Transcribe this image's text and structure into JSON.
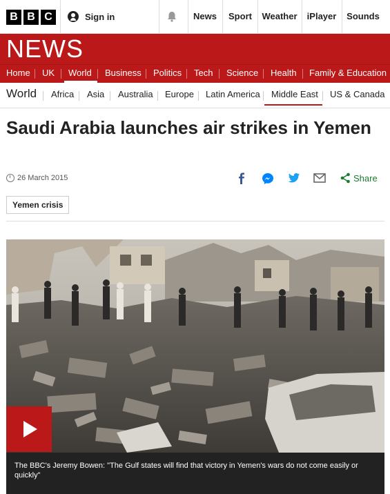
{
  "header": {
    "logo_letters": [
      "B",
      "B",
      "C"
    ],
    "signin_label": "Sign in",
    "nav": [
      "News",
      "Sport",
      "Weather",
      "iPlayer",
      "Sounds"
    ]
  },
  "banner": {
    "title": "NEWS"
  },
  "main_nav": {
    "items": [
      "Home",
      "UK",
      "World",
      "Business",
      "Politics",
      "Tech",
      "Science",
      "Health",
      "Family & Education"
    ],
    "active": "World"
  },
  "sub_nav": {
    "section": "World",
    "items": [
      "Africa",
      "Asia",
      "Australia",
      "Europe",
      "Latin America",
      "Middle East",
      "US & Canada"
    ],
    "active": "Middle East"
  },
  "article": {
    "headline": "Saudi Arabia launches air strikes in Yemen",
    "date": "26 March 2015",
    "share_label": "Share",
    "tag": "Yemen crisis",
    "caption": "The BBC's Jeremy Bowen: \"The Gulf states will find that victory in Yemen's wars do not come easily or quickly\""
  },
  "share_icons": [
    "facebook-icon",
    "messenger-icon",
    "twitter-icon",
    "email-icon",
    "share-icon"
  ],
  "colors": {
    "brand_red": "#bb1919",
    "share_green": "#1a7a2e",
    "facebook_blue": "#3b5998",
    "twitter_blue": "#1da1f2",
    "messenger_blue": "#0084ff"
  }
}
